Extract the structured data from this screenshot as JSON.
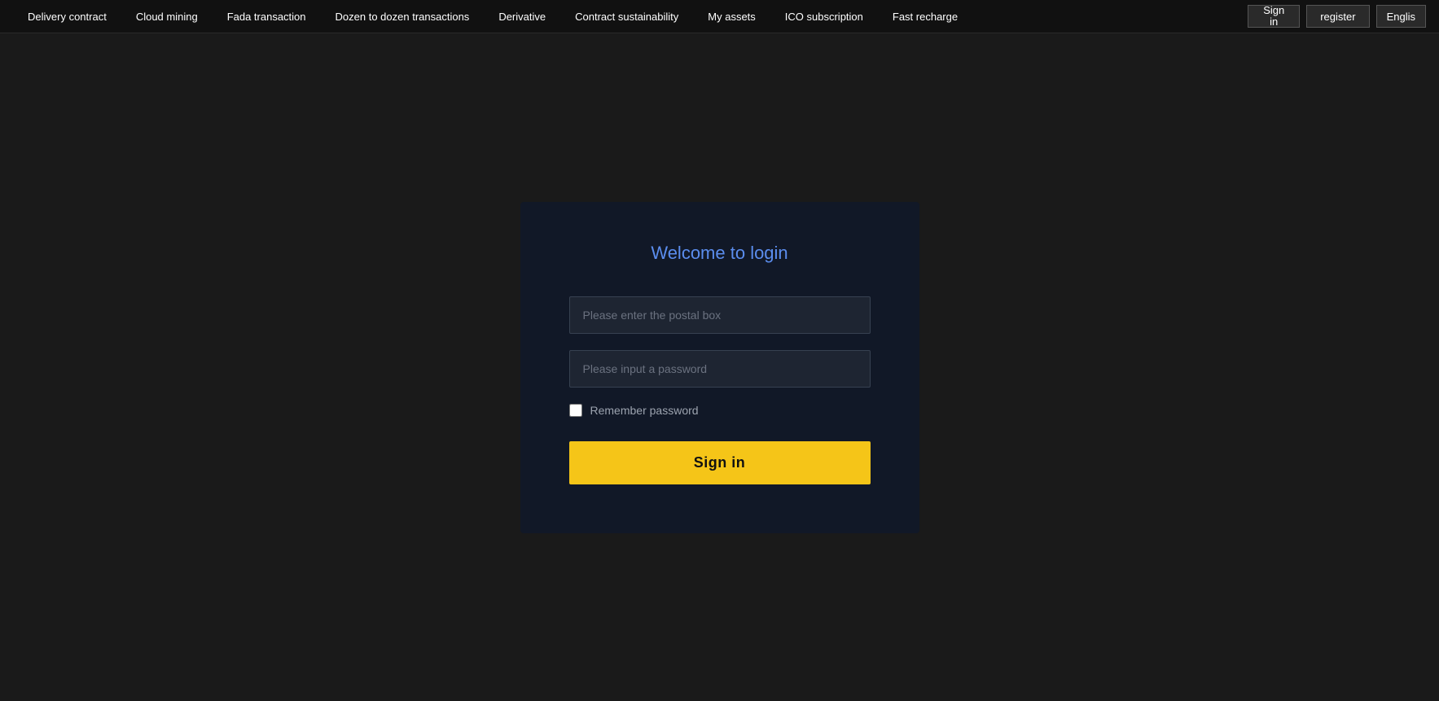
{
  "navbar": {
    "items": [
      {
        "id": "delivery-contract",
        "label": "Delivery contract",
        "active": false
      },
      {
        "id": "cloud-mining",
        "label": "Cloud mining",
        "active": false
      },
      {
        "id": "fada-transaction",
        "label": "Fada transaction",
        "active": false
      },
      {
        "id": "dozen-to-dozen",
        "label": "Dozen to dozen transactions",
        "active": false
      },
      {
        "id": "derivative",
        "label": "Derivative",
        "active": false
      },
      {
        "id": "contract-sustainability",
        "label": "Contract sustainability",
        "active": false
      },
      {
        "id": "my-assets",
        "label": "My assets",
        "active": false
      },
      {
        "id": "ico-subscription",
        "label": "ICO subscription",
        "active": false
      },
      {
        "id": "fast-recharge",
        "label": "Fast recharge",
        "active": false
      }
    ],
    "sign_in_line1": "Sign",
    "sign_in_line2": "in",
    "register_label": "register",
    "lang_label": "Englis"
  },
  "login": {
    "title": "Welcome to login",
    "email_placeholder": "Please enter the postal box",
    "password_placeholder": "Please input a password",
    "remember_label": "Remember password",
    "sign_in_button": "Sign in"
  }
}
